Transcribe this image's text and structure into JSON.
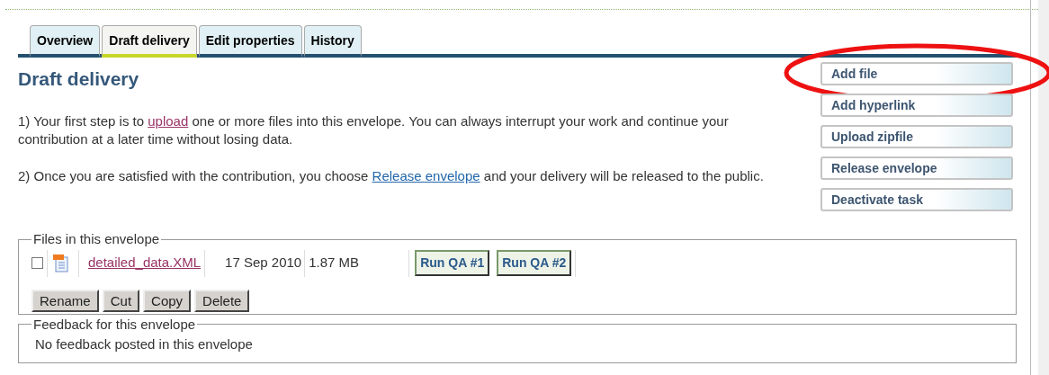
{
  "tabs": [
    {
      "label": "Overview",
      "selected": false
    },
    {
      "label": "Draft delivery",
      "selected": true
    },
    {
      "label": "Edit properties",
      "selected": false
    },
    {
      "label": "History",
      "selected": false
    }
  ],
  "heading": "Draft delivery",
  "paragraphs": [
    [
      {
        "text": "1) Your first step is to ",
        "kind": "text"
      },
      {
        "text": "upload",
        "kind": "link"
      },
      {
        "text": " one or more files into this envelope. You can always interrupt your work and continue your contribution at a later time without losing data.",
        "kind": "text"
      }
    ],
    [
      {
        "text": "2) Once you are satisfied with the contribution, you choose ",
        "kind": "text"
      },
      {
        "text": "Release envelope",
        "kind": "link"
      },
      {
        "text": " and your delivery will be released to the public.",
        "kind": "text"
      }
    ]
  ],
  "actions": [
    {
      "label": "Add file",
      "circled": true
    },
    {
      "label": "Add hyperlink",
      "circled": false
    },
    {
      "label": "Upload zipfile",
      "circled": false
    },
    {
      "label": "Release envelope",
      "circled": false
    },
    {
      "label": "Deactivate task",
      "circled": false
    }
  ],
  "files": {
    "legend": "Files in this envelope",
    "rows": [
      {
        "checked": false,
        "name": "detailed_data.XML",
        "date": "17 Sep 2010",
        "size": "1.87 MB",
        "qa": [
          "Run QA #1",
          "Run QA #2"
        ]
      }
    ],
    "buttons": [
      "Rename",
      "Cut",
      "Copy",
      "Delete"
    ]
  },
  "feedback": {
    "legend": "Feedback for this envelope",
    "text": "No feedback posted in this envelope"
  }
}
